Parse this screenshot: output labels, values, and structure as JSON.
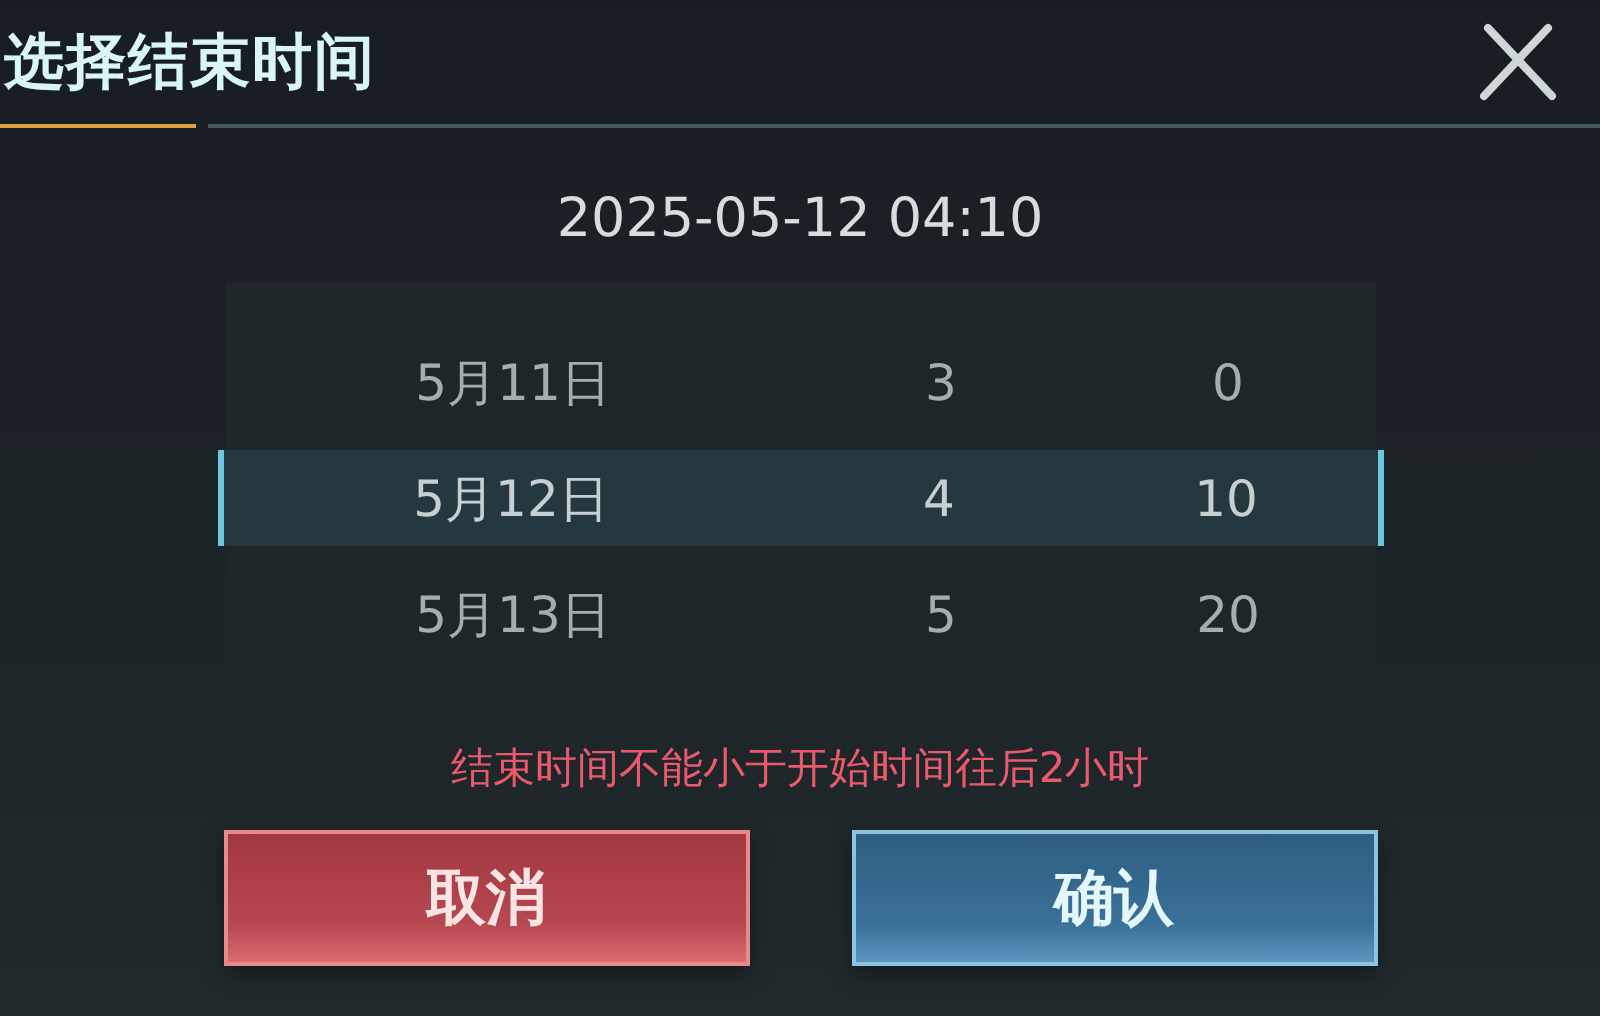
{
  "title": "选择结束时间",
  "current_value": "2025-05-12 04:10",
  "wheel_rows": [
    {
      "date": "5月11日",
      "hour": "3",
      "minute": "0",
      "selected": false
    },
    {
      "date": "5月12日",
      "hour": "4",
      "minute": "10",
      "selected": true
    },
    {
      "date": "5月13日",
      "hour": "5",
      "minute": "20",
      "selected": false
    }
  ],
  "error_message": "结束时间不能小于开始时间往后2小时",
  "buttons": [
    {
      "label": "取消",
      "kind": "cancel"
    },
    {
      "label": "确认",
      "kind": "confirm"
    }
  ]
}
